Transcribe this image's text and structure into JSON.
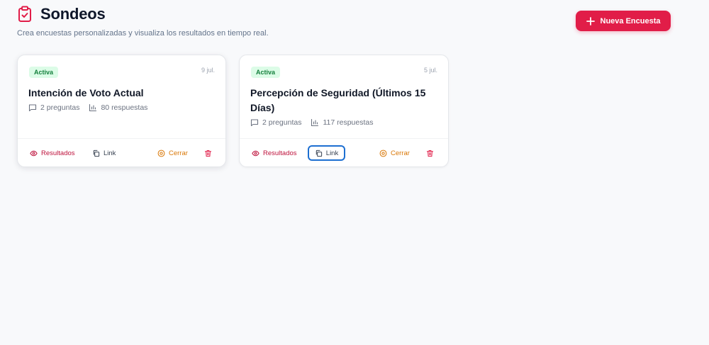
{
  "header": {
    "title": "Sondeos",
    "subtitle": "Crea encuestas personalizadas y visualiza los resultados en tiempo real.",
    "title_icon": "clipboard-check-icon",
    "new_button_label": "Nueva Encuesta"
  },
  "colors": {
    "accent": "#e11d48",
    "badge_bg": "#dcfce7",
    "badge_text": "#15803d",
    "close_text": "#d97706",
    "focus_ring": "#1d6fd1"
  },
  "surveys": [
    {
      "status": "Activa",
      "date": "9 jul.",
      "title": "Intención de Voto Actual",
      "questions": "2 preguntas",
      "responses": "80 respuestas",
      "actions": {
        "results": "Resultados",
        "link": "Link",
        "close": "Cerrar"
      }
    },
    {
      "status": "Activa",
      "date": "5 jul.",
      "title": "Percepción de Seguridad (Últimos 15 Días)",
      "questions": "2 preguntas",
      "responses": "117 respuestas",
      "actions": {
        "results": "Resultados",
        "link": "Link",
        "close": "Cerrar"
      }
    }
  ]
}
